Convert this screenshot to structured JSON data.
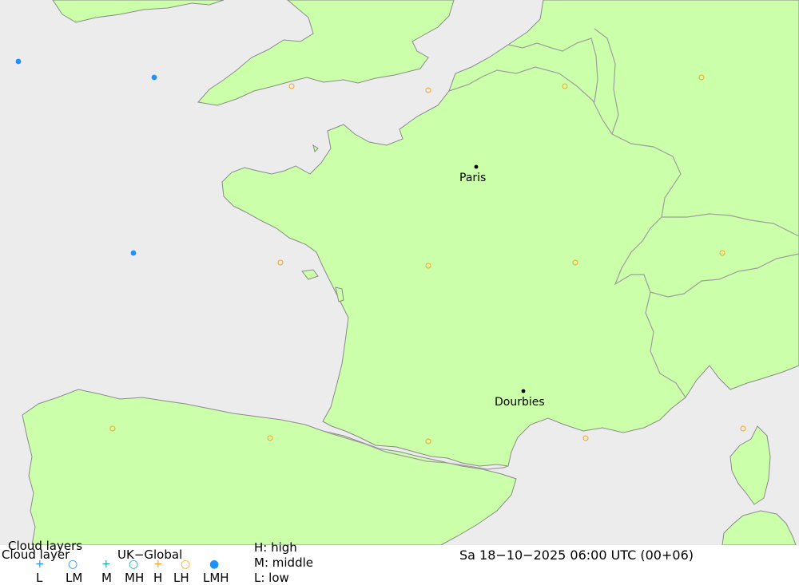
{
  "map": {
    "cities": [
      {
        "name": "Paris",
        "label": "Paris"
      },
      {
        "name": "Dourbies",
        "label": "Dourbies"
      }
    ],
    "colors": {
      "sea": "#ececec",
      "land": "#ccffaa",
      "border": "#9e9e9e",
      "coast": "#8a8a8a",
      "symbol_orange": "#f5a623",
      "symbol_blue": "#1e90ff",
      "symbol_teal": "#1aa8a8"
    }
  },
  "legend": {
    "title_top": "Cloud layers",
    "title_main": "Cloud layer",
    "model": "UK−Global",
    "items": [
      {
        "symbol": "+",
        "label": "L",
        "color": "#1e90ff"
      },
      {
        "symbol": "○",
        "label": "LM",
        "color": "#1e90ff"
      },
      {
        "symbol": "+",
        "label": "M",
        "color": "#1aa8a8"
      },
      {
        "symbol": "○",
        "label": "MH",
        "color": "#1aa8a8"
      },
      {
        "symbol": "+",
        "label": "H",
        "color": "#f5a623"
      },
      {
        "symbol": "○",
        "label": "LH",
        "color": "#f5a623"
      },
      {
        "symbol": "●",
        "label": "LMH",
        "color": "#1e90ff"
      }
    ],
    "key": {
      "high": "H: high",
      "middle": "M: middle",
      "low": "L: low"
    },
    "datetime": "Sa 18−10−2025 06:00 UTC (00+06)"
  }
}
